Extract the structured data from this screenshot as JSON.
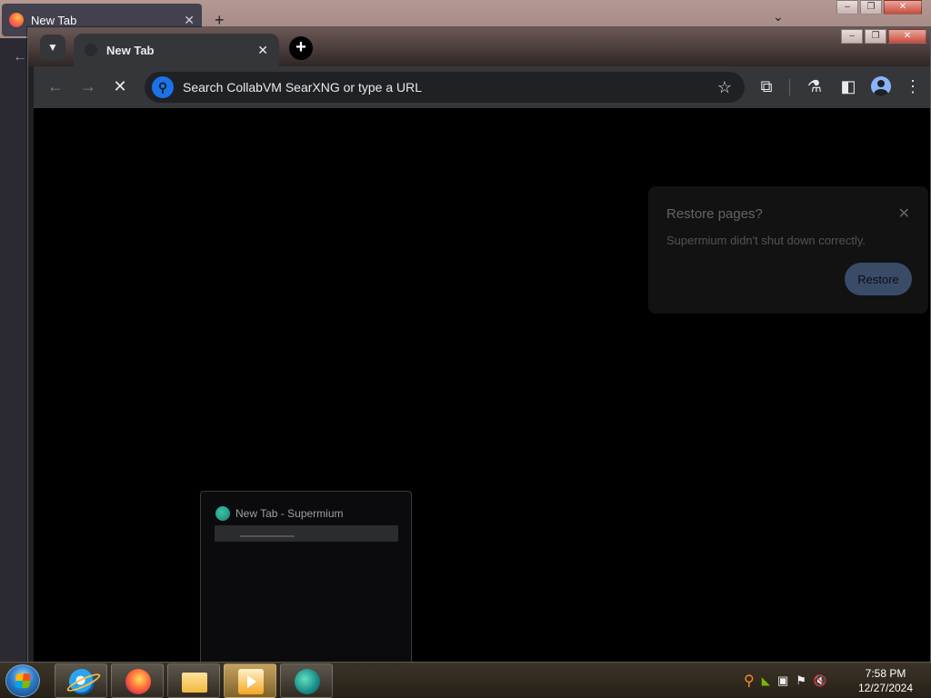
{
  "firefox": {
    "tab_title": "New Tab",
    "tab_close": "✕",
    "new_tab": "+",
    "tab_list": "⌄"
  },
  "window_controls": {
    "minimize": "–",
    "maximize": "❐",
    "close": "✕"
  },
  "supermium": {
    "tab_title": "New Tab",
    "tab_close": "✕",
    "new_tab": "+",
    "omnibox_placeholder": "Search CollabVM SearXNG or type a URL",
    "icons": {
      "tab_search": "chevron-down-icon",
      "back": "arrow-left-icon",
      "forward": "arrow-right-icon",
      "stop": "close-icon",
      "search": "search-icon",
      "bookmark": "star-icon",
      "extensions": "puzzle-icon",
      "labs": "flask-icon",
      "side_panel": "side-panel-icon",
      "profile": "avatar-icon",
      "menu": "more-vert-icon"
    }
  },
  "restore_popup": {
    "title": "Restore pages?",
    "message": "Supermium didn't shut down correctly.",
    "button": "Restore"
  },
  "taskbar_preview": {
    "title": "New Tab - Supermium"
  },
  "taskbar": {
    "pinned": [
      "Internet Explorer",
      "Firefox",
      "Windows Explorer",
      "Windows Media Player",
      "Supermium"
    ],
    "active": "Supermium"
  },
  "clock": {
    "time": "7:58 PM",
    "date": "12/27/2024"
  },
  "colors": {
    "chrome_dark": "#35363a",
    "content": "#000000",
    "accent": "#8ab4f8"
  }
}
